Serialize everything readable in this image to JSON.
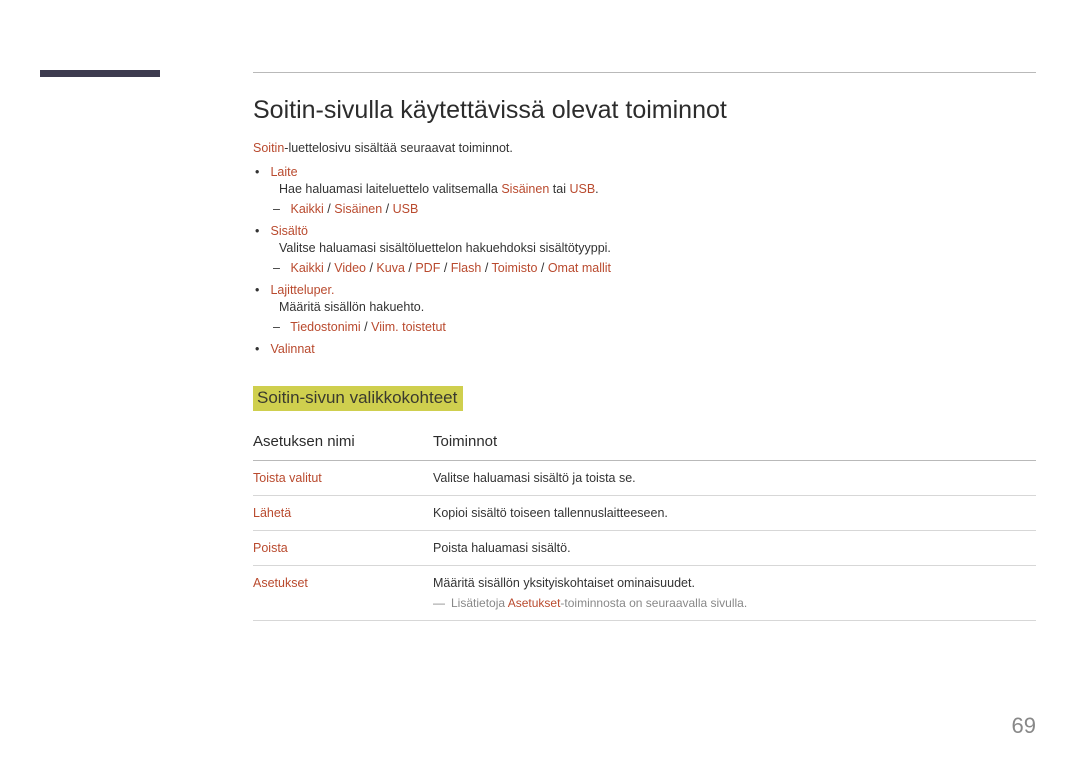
{
  "page_number": "69",
  "heading": "Soitin-sivulla käytettävissä olevat toiminnot",
  "intro_prefix": "Soitin",
  "intro_rest": "-luettelosivu sisältää seuraavat toiminnot.",
  "bullets": {
    "b1": {
      "title": "Laite",
      "desc_before": "Hae haluamasi laiteluettelo valitsemalla ",
      "opt1": "Sisäinen",
      "mid": " tai ",
      "opt2": "USB",
      "after": ".",
      "sub": {
        "p1": "Kaikki",
        "p2": "Sisäinen",
        "p3": "USB"
      }
    },
    "b2": {
      "title": "Sisältö",
      "desc": "Valitse haluamasi sisältöluettelon hakuehdoksi sisältötyyppi.",
      "sub": {
        "p1": "Kaikki",
        "p2": "Video",
        "p3": "Kuva",
        "p4": "PDF",
        "p5": "Flash",
        "p6": "Toimisto",
        "p7": "Omat mallit"
      }
    },
    "b3": {
      "title": "Lajitteluper.",
      "desc": "Määritä sisällön hakuehto.",
      "sub": {
        "p1": "Tiedostonimi",
        "p2": "Viim. toistetut"
      }
    },
    "b4": {
      "title": "Valinnat"
    }
  },
  "subheading": "Soitin-sivun valikkokohteet",
  "table": {
    "head": {
      "c1": "Asetuksen nimi",
      "c2": "Toiminnot"
    },
    "rows": [
      {
        "name": "Toista valitut",
        "desc": "Valitse haluamasi sisältö ja toista se."
      },
      {
        "name": "Lähetä",
        "desc": "Kopioi sisältö toiseen tallennuslaitteeseen."
      },
      {
        "name": "Poista",
        "desc": "Poista haluamasi sisältö."
      },
      {
        "name": "Asetukset",
        "desc": "Määritä sisällön yksityiskohtaiset ominaisuudet."
      }
    ],
    "note_before": "Lisätietoja ",
    "note_brand": "Asetukset",
    "note_after": "-toiminnosta on seuraavalla sivulla."
  },
  "slash": " / "
}
